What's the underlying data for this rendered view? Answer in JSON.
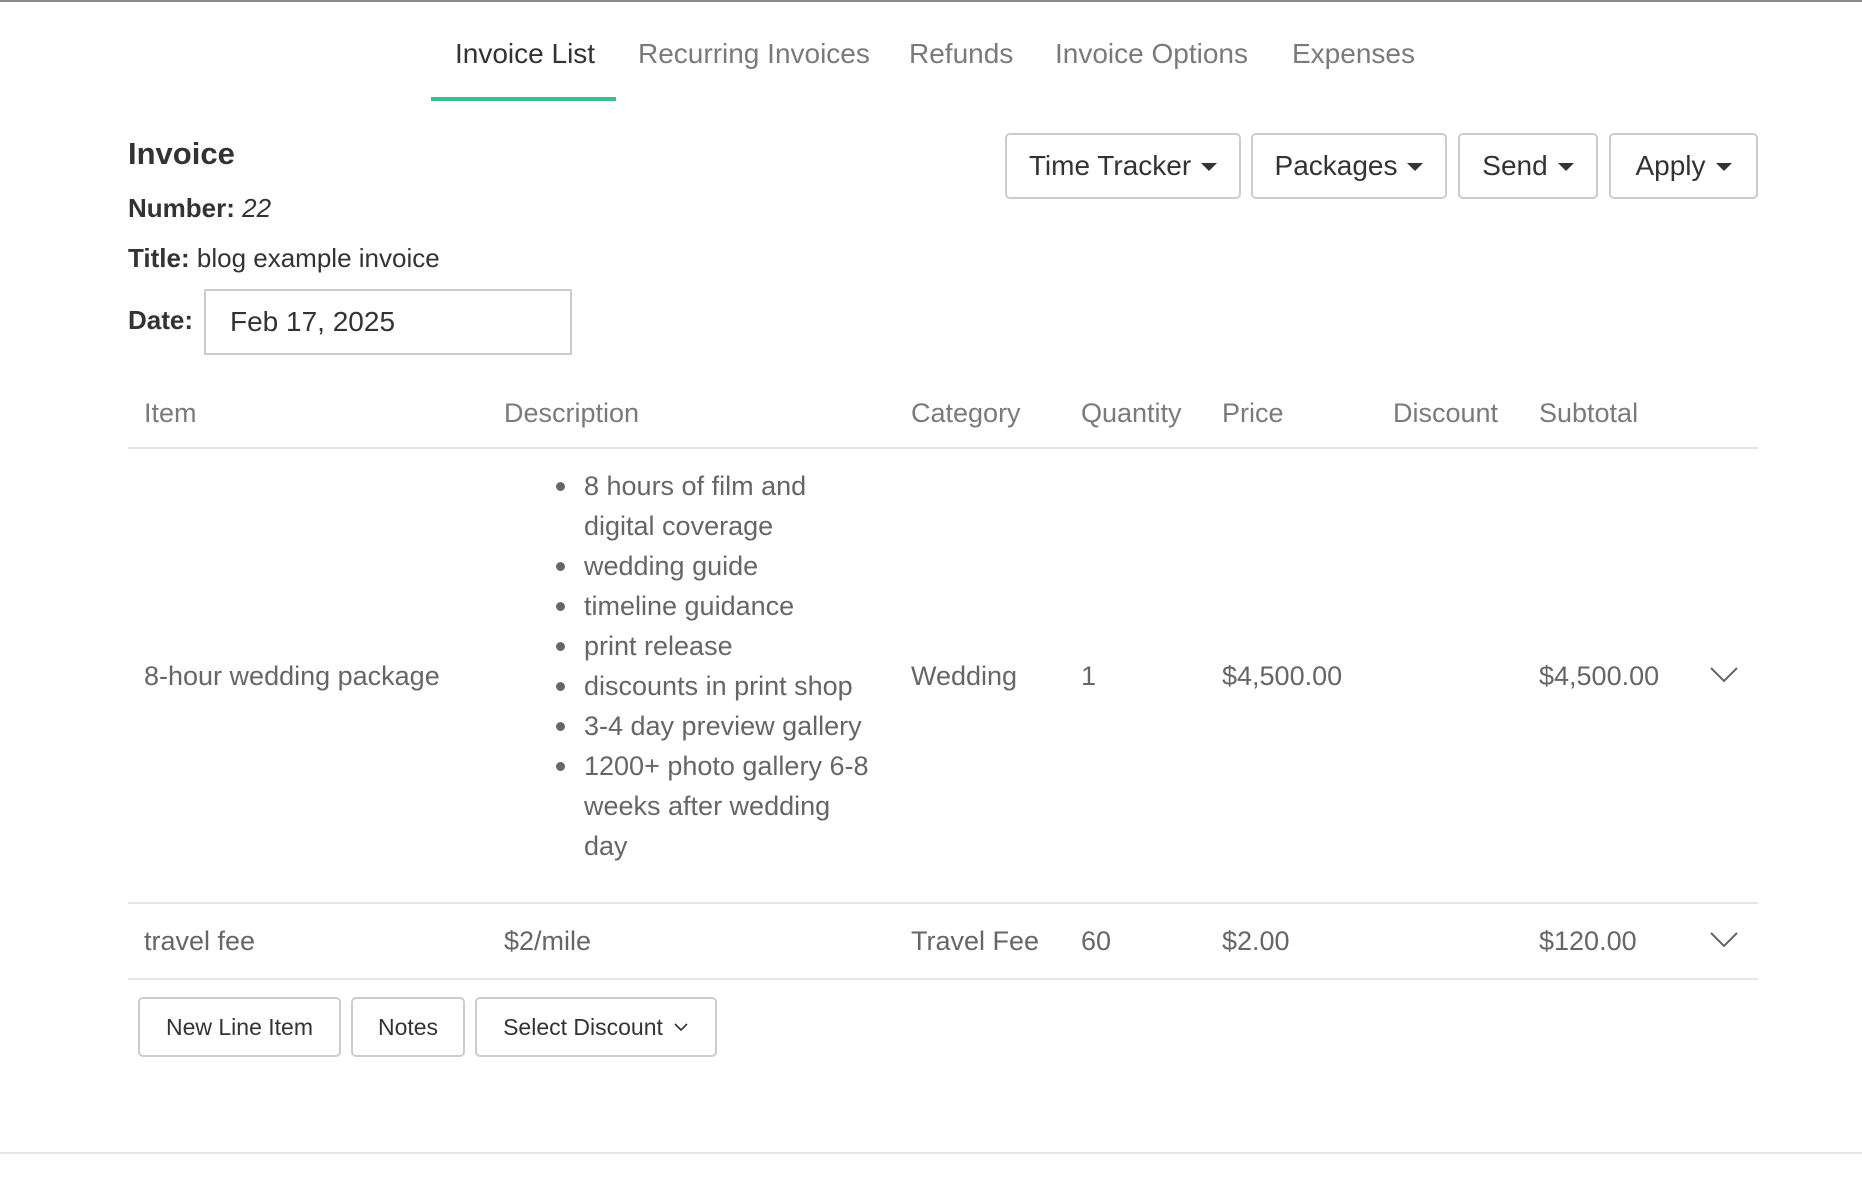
{
  "tabs": [
    {
      "label": "Invoice List",
      "active": true
    },
    {
      "label": "Recurring Invoices",
      "active": false
    },
    {
      "label": "Refunds",
      "active": false
    },
    {
      "label": "Invoice Options",
      "active": false
    },
    {
      "label": "Expenses",
      "active": false
    }
  ],
  "invoice": {
    "heading": "Invoice",
    "number_label": "Number:",
    "number": "22",
    "title_label": "Title:",
    "title": "blog example invoice",
    "date_label": "Date:",
    "date": "Feb 17, 2025"
  },
  "actions": {
    "time_tracker": "Time Tracker",
    "packages": "Packages",
    "send": "Send",
    "apply": "Apply"
  },
  "table": {
    "headers": [
      "Item",
      "Description",
      "Category",
      "Quantity",
      "Price",
      "Discount",
      "Subtotal"
    ],
    "rows": [
      {
        "item": "8-hour wedding package",
        "description_lines": [
          "8 hours of film and  digital coverage",
          "wedding guide",
          "timeline guidance",
          "print release",
          "discounts in print shop",
          "3-4 day preview gallery",
          "1200+ photo gallery 6-8 weeks after wedding day"
        ],
        "category": "Wedding",
        "quantity": "1",
        "price": "$4,500.00",
        "discount": "",
        "subtotal": "$4,500.00"
      },
      {
        "item": "travel fee",
        "description": "$2/mile",
        "category": "Travel Fee",
        "quantity": "60",
        "price": "$2.00",
        "discount": "",
        "subtotal": "$120.00"
      }
    ]
  },
  "footer": {
    "new_line_item": "New Line Item",
    "notes": "Notes",
    "select_discount": "Select Discount"
  },
  "colors": {
    "accent": "#3cbf8f",
    "border": "#cccccc",
    "muted_text": "#7a7a7a"
  },
  "icons": [
    "caret-down-icon",
    "chevron-down-icon"
  ]
}
